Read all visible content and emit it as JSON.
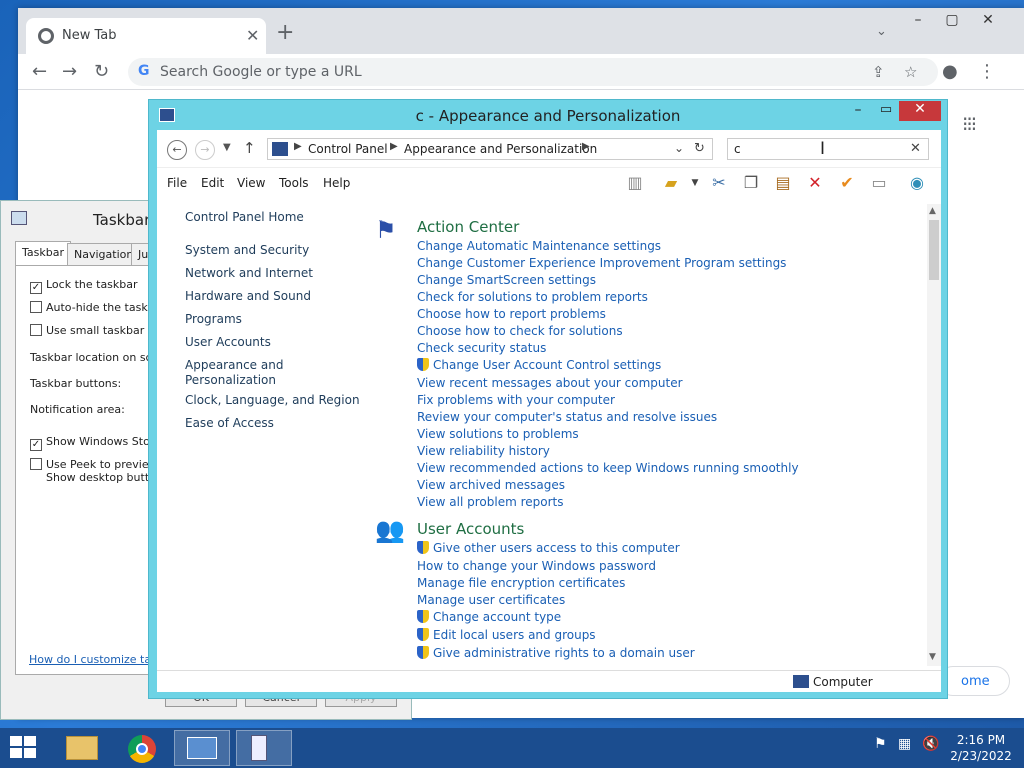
{
  "chrome": {
    "tab_title": "New Tab",
    "omnibox_placeholder": "Search Google or type a URL",
    "customize_label": "ome"
  },
  "taskbar_props": {
    "title": "Taskbar",
    "tabs": [
      "Taskbar",
      "Navigation",
      "Ju"
    ],
    "lock_taskbar": "Lock the taskbar",
    "auto_hide": "Auto-hide the taskbar",
    "small_buttons": "Use small taskbar butt",
    "location_label": "Taskbar location on scree",
    "buttons_label": "Taskbar buttons:",
    "notification_label": "Notification area:",
    "show_store": "Show Windows Store",
    "peek_line1": "Use Peek to preview t",
    "peek_line2": "Show desktop button",
    "help_link": "How do I customize taskb",
    "ok": "OK",
    "cancel": "Cancel",
    "apply": "Apply"
  },
  "cp": {
    "title": "c - Appearance and Personalization",
    "breadcrumb": [
      "Control Panel",
      "Appearance and Personalization"
    ],
    "search_value": "c",
    "menu": [
      "File",
      "Edit",
      "View",
      "Tools",
      "Help"
    ],
    "left_nav": [
      "Control Panel Home",
      "System and Security",
      "Network and Internet",
      "Hardware and Sound",
      "Programs",
      "User Accounts",
      "Appearance and",
      "Personalization",
      "Clock, Language, and Region",
      "Ease of Access"
    ],
    "action_center": {
      "title": "Action Center",
      "tasks": [
        "Change Automatic Maintenance settings",
        "Change Customer Experience Improvement Program settings",
        "Change SmartScreen settings",
        "Check for solutions to problem reports",
        "Choose how to report problems",
        "Choose how to check for solutions",
        "Check security status",
        "Change User Account Control settings",
        "View recent messages about your computer",
        "Fix problems with your computer",
        "Review your computer's status and resolve issues",
        "View solutions to problems",
        "View reliability history",
        "View recommended actions to keep Windows running smoothly",
        "View archived messages",
        "View all problem reports"
      ]
    },
    "user_accounts": {
      "title": "User Accounts",
      "tasks": [
        "Give other users access to this computer",
        "How to change your Windows password",
        "Manage file encryption certificates",
        "Manage user certificates",
        "Change account type",
        "Edit local users and groups",
        "Give administrative rights to a domain user"
      ]
    },
    "status_text": "Computer"
  },
  "clock": {
    "time": "2:16 PM",
    "date": "2/23/2022"
  }
}
